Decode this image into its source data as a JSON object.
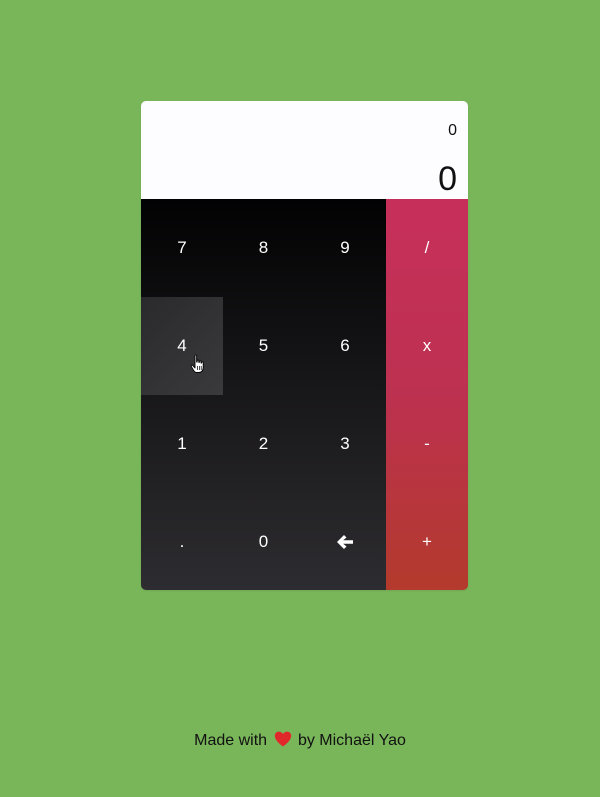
{
  "display": {
    "history": "0",
    "result": "0"
  },
  "keypad": {
    "rows": [
      [
        "7",
        "8",
        "9"
      ],
      [
        "4",
        "5",
        "6"
      ],
      [
        "1",
        "2",
        "3"
      ],
      [
        ".",
        "0",
        "backspace"
      ]
    ],
    "hovered_key": "4"
  },
  "operators": [
    "/",
    "x",
    "-",
    "+"
  ],
  "footer": {
    "prefix": "Made with",
    "icon": "heart-icon",
    "suffix": "by Michaël Yao"
  },
  "colors": {
    "background": "#79b65a",
    "display": "#fdfcff",
    "operator_top": "#c72f5b",
    "operator_bottom": "#b33a2c",
    "heart": "#e0282b"
  }
}
